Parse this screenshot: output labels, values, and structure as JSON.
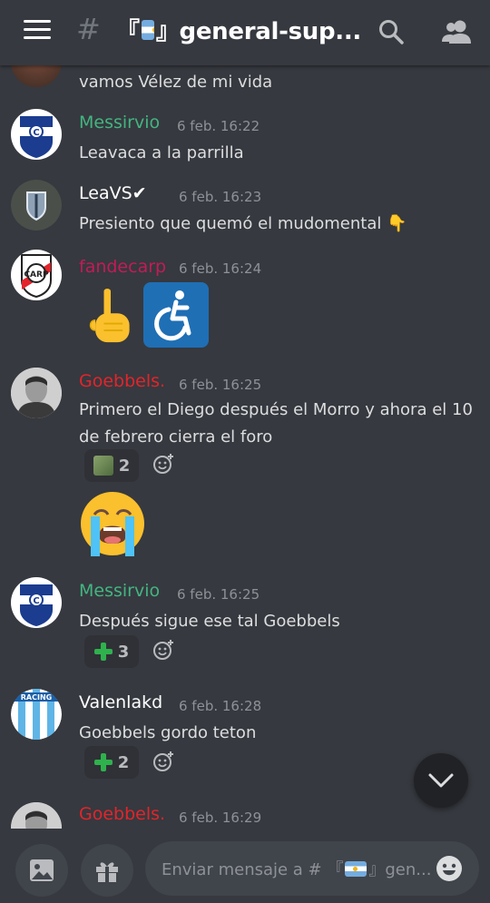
{
  "header": {
    "hash": "#",
    "title_prefix": "『",
    "title_suffix": "』general-sup..."
  },
  "messages": [
    {
      "text": "vamos Vélez de mi vida"
    },
    {
      "author": "Messirvio",
      "author_color": "#43b581",
      "timestamp": "6 feb. 16:22",
      "text": "Leavaca a la parrilla"
    },
    {
      "author": "LeaVS✔",
      "author_color": "#ffffff",
      "timestamp": "6 feb. 16:23",
      "text": "Presiento que quemó el mudomental 👇"
    },
    {
      "author": "fandecarp",
      "author_color": "#c31b58",
      "timestamp": "6 feb. 16:24",
      "emojis": [
        "point-up-emoji",
        "wheelchair-emoji"
      ]
    },
    {
      "author": "Goebbels.",
      "author_color": "#e3242b",
      "timestamp": "6 feb. 16:25",
      "text": "Primero el Diego después el Morro y ahora el 10 de febrero cierra el foro",
      "reaction_count": "2",
      "extra_emoji": "crying-face-emoji"
    },
    {
      "author": "Messirvio",
      "author_color": "#43b581",
      "timestamp": "6 feb. 16:25",
      "text": "Después sigue ese tal Goebbels",
      "reaction_count": "3"
    },
    {
      "author": "Valenlakd",
      "author_color": "#ffffff",
      "timestamp": "6 feb. 16:28",
      "text": "Goebbels gordo teton",
      "reaction_count": "2"
    },
    {
      "author": "Goebbels.",
      "author_color": "#e3242b",
      "timestamp": "6 feb. 16:29"
    }
  ],
  "composer": {
    "placeholder_prefix": "Enviar mensaje a # 『",
    "placeholder_suffix": "』gen..."
  },
  "colors": {
    "background": "#36393f",
    "input": "#40444b",
    "timestamp": "#8e9297"
  }
}
